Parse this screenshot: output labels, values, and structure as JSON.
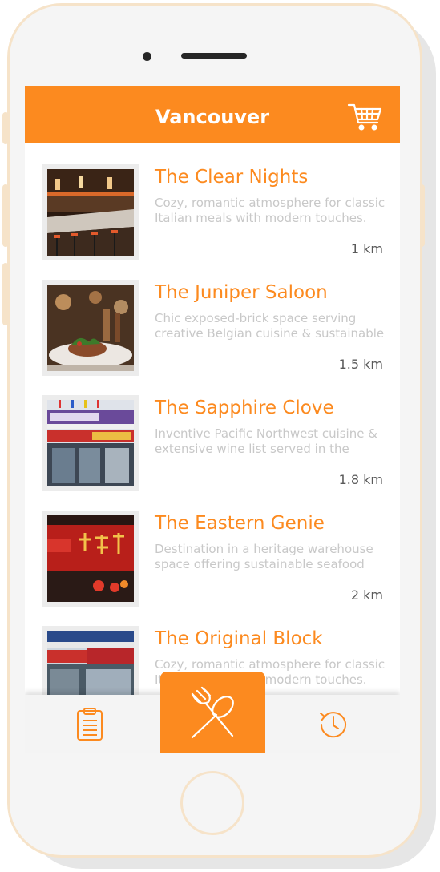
{
  "header": {
    "title": "Vancouver",
    "cart_icon": "shopping-cart-icon"
  },
  "colors": {
    "accent": "#fc8a1f",
    "description_text": "#c8c8c8",
    "distance_text": "#5a5a5a",
    "frame": "#f6e3c9"
  },
  "restaurants": [
    {
      "name": "The Clear Nights",
      "description": "Cozy, romantic atmosphere for classic Italian meals with modern touches.",
      "distance": "1 km",
      "image": "restaurant-bar-interior-photo"
    },
    {
      "name": "The Juniper Saloon",
      "description": "Chic exposed-brick space serving creative Belgian cuisine & sustainable",
      "distance": "1.5 km",
      "image": "plated-dish-photo"
    },
    {
      "name": "The Sapphire Clove",
      "description": "Inventive Pacific Northwest cuisine & extensive wine list served in the",
      "distance": "1.8 km",
      "image": "storefront-lotus-restaurant-photo"
    },
    {
      "name": "The Eastern Genie",
      "description": "Destination in a heritage warehouse space offering sustainable seafood",
      "distance": "2 km",
      "image": "red-chinese-signage-photo"
    },
    {
      "name": "The Original Block",
      "description": "Cozy, romantic atmosphere for classic Italian meals with modern touches.",
      "distance": "",
      "image": "peaceful-restaurant-storefront-photo"
    }
  ],
  "tabs": [
    {
      "name": "orders",
      "icon": "clipboard-icon",
      "active": false
    },
    {
      "name": "restaurants",
      "icon": "fork-spoon-icon",
      "active": true
    },
    {
      "name": "history",
      "icon": "clock-history-icon",
      "active": false
    }
  ]
}
